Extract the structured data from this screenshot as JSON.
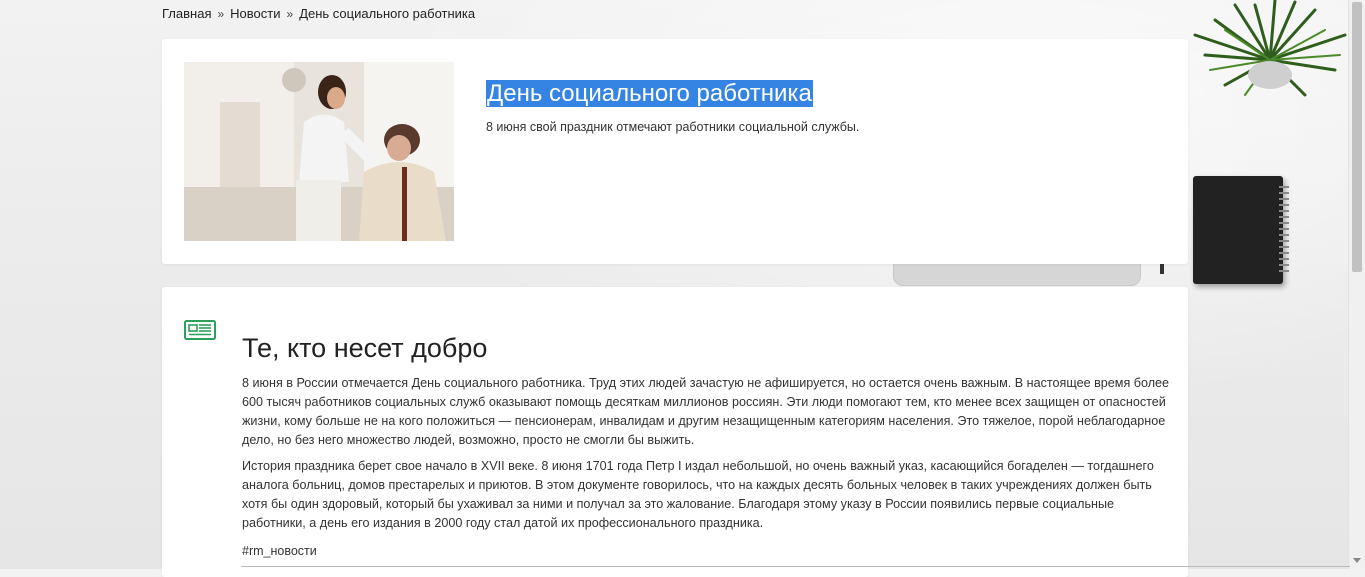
{
  "breadcrumb": {
    "items": [
      "Главная",
      "Новости",
      "День социального работника"
    ]
  },
  "hero": {
    "title": "День социального работника",
    "subtitle": "8 июня свой праздник отмечают работники социальной службы."
  },
  "article": {
    "title": "Те, кто несет добро",
    "paragraphs": [
      "8 июня в России отмечается День социального работника. Труд этих людей зачастую не афишируется, но остается очень важным. В настоящее время более 600 тысяч работников социальных служб оказывают помощь десяткам миллионов россиян. Эти люди помогают тем, кто менее всех защищен от опасностей жизни, кому больше не на кого положиться — пенсионерам, инвалидам и другим незащищенным категориям населения. Это тяжелое, порой неблагодарное дело, но без него множество людей, возможно, просто не смогли бы выжить.",
      "История праздника берет свое начало в XVII веке. 8 июня 1701 года Петр I издал небольшой, но очень важный указ, касающийся богаделен — тогдашнего аналога больниц, домов престарелых и приютов. В этом документе говорилось, что на каждых десять больных человек в таких учреждениях должен быть хотя бы один здоровый, который бы ухаживал за ними и получал за это жалование.  Благодаря этому указу в России появились первые социальные работники, а день его издания в 2000 году стал датой их профессионального праздника."
    ],
    "tag": "#rm_новости"
  },
  "icons": {
    "breadcrumb_separator": "»",
    "news": "newspaper-icon"
  },
  "colors": {
    "selection_highlight": "#3584e4",
    "news_icon": "#2e9e5b"
  }
}
